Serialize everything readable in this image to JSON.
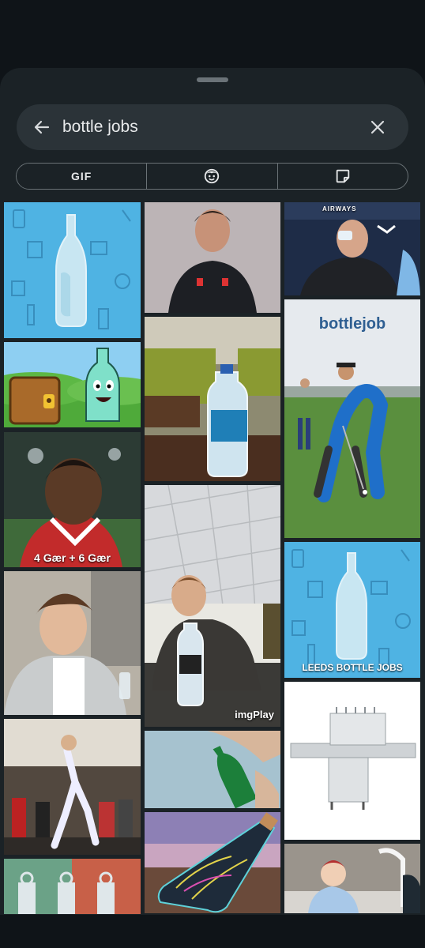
{
  "search": {
    "query": "bottle jobs",
    "back_icon": "arrow-left-icon",
    "clear_icon": "close-icon"
  },
  "tabs": [
    {
      "label": "GIF",
      "icon": "gif-icon",
      "active": true
    },
    {
      "label": "",
      "icon": "emoji-face-icon",
      "active": false
    },
    {
      "label": "",
      "icon": "sticker-icon",
      "active": false
    }
  ],
  "results": [
    {
      "subject": "glass bottle illustration on blue"
    },
    {
      "subject": "man in dark Arsenal jacket"
    },
    {
      "subject": "man drinking from bottle in stadium",
      "text": "AIRWAYS"
    },
    {
      "subject": "cartoon bottle and chest"
    },
    {
      "subject": "water bottle on table"
    },
    {
      "subject": "golfer swinging",
      "text": "bottlejob"
    },
    {
      "subject": "footballer in red shirt",
      "text": "4 Gær + 6 Gær"
    },
    {
      "subject": "boy throwing bottle",
      "text": "imgPlay"
    },
    {
      "subject": "young man holding bottle"
    },
    {
      "subject": "bottle illustration",
      "text": "LEEDS BOTTLE JOBS"
    },
    {
      "subject": "person dancing in room"
    },
    {
      "subject": "hand with green bottle"
    },
    {
      "subject": "bottle filling machine"
    },
    {
      "subject": "water bottles on counter"
    },
    {
      "subject": "decorated glass bottle"
    },
    {
      "subject": "baby crawling"
    }
  ],
  "colors": {
    "background": "#0f1418",
    "sheet": "#1b2226",
    "search_bg": "#2b3338",
    "text": "#e8eaeb",
    "accent_blue": "#4fb3e3"
  }
}
